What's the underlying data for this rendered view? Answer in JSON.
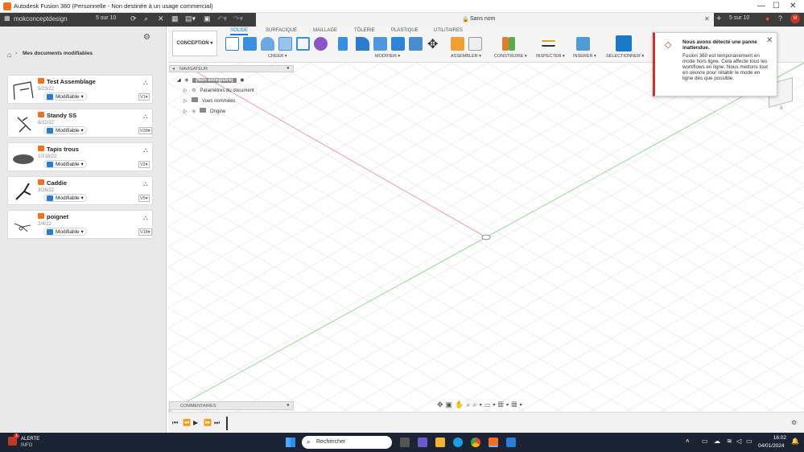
{
  "window": {
    "title": "Autodesk Fusion 360 (Personnelle - Non destinée à un usage commercial)",
    "tab_title": "Sans nom"
  },
  "topbar": {
    "team_name": "mokconceptdesign",
    "counter_left": "5 sur 10",
    "counter_right": "5 sur 10"
  },
  "datapanel": {
    "breadcrumb": "Mes documents modifiables",
    "files": [
      {
        "name": "Test Assemblage",
        "date": "5/23/22",
        "status": "Modifiable",
        "version": "V1"
      },
      {
        "name": "Standy SS",
        "date": "8/22/22",
        "status": "Modifiable",
        "version": "V28"
      },
      {
        "name": "Tapis trous",
        "date": "10/18/22",
        "status": "Modifiable",
        "version": "V2"
      },
      {
        "name": "Caddie",
        "date": "3/26/22",
        "status": "Modifiable",
        "version": "V5"
      },
      {
        "name": "poignet",
        "date": "2/4/22",
        "status": "Modifiable",
        "version": "V18"
      }
    ]
  },
  "ribbon": {
    "workspace": "CONCEPTION",
    "tabs": [
      "SOLIDE",
      "SURFACIQUE",
      "MAILLAGE",
      "TÔLERIE",
      "PLASTIQUE",
      "UTILITAIRES"
    ],
    "groups": {
      "create": "CRÉER",
      "modify": "MODIFIER",
      "assemble": "ASSEMBLER",
      "construct": "CONSTRUIRE",
      "inspect": "INSPECTER",
      "insert": "INSÉRER",
      "select": "SÉLECTIONNER"
    }
  },
  "browser": {
    "header": "NAVIGATEUR",
    "root": "(Non enregistré)",
    "items": [
      "Paramètres du document",
      "Vues nommées",
      "Origine"
    ]
  },
  "comments": "COMMENTAIRES",
  "toast": {
    "title": "Nous avons détecté une panne inattendue.",
    "message": "Fusion 360 est temporairement en mode hors ligne. Cela affecte tous les workflows en ligne. Nous mettons tout en oeuvre pour rétablir le mode en ligne dès que possible."
  },
  "taskbar": {
    "alert_title": "ALERTE",
    "alert_sub": "INFO",
    "alert_badge": "1",
    "search_placeholder": "Rechercher",
    "time": "16:02",
    "date": "04/01/2024"
  },
  "colors": {
    "accent": "#1b79c9",
    "brand": "#f37021",
    "axis_x": "#e06060",
    "axis_y": "#60c060"
  }
}
